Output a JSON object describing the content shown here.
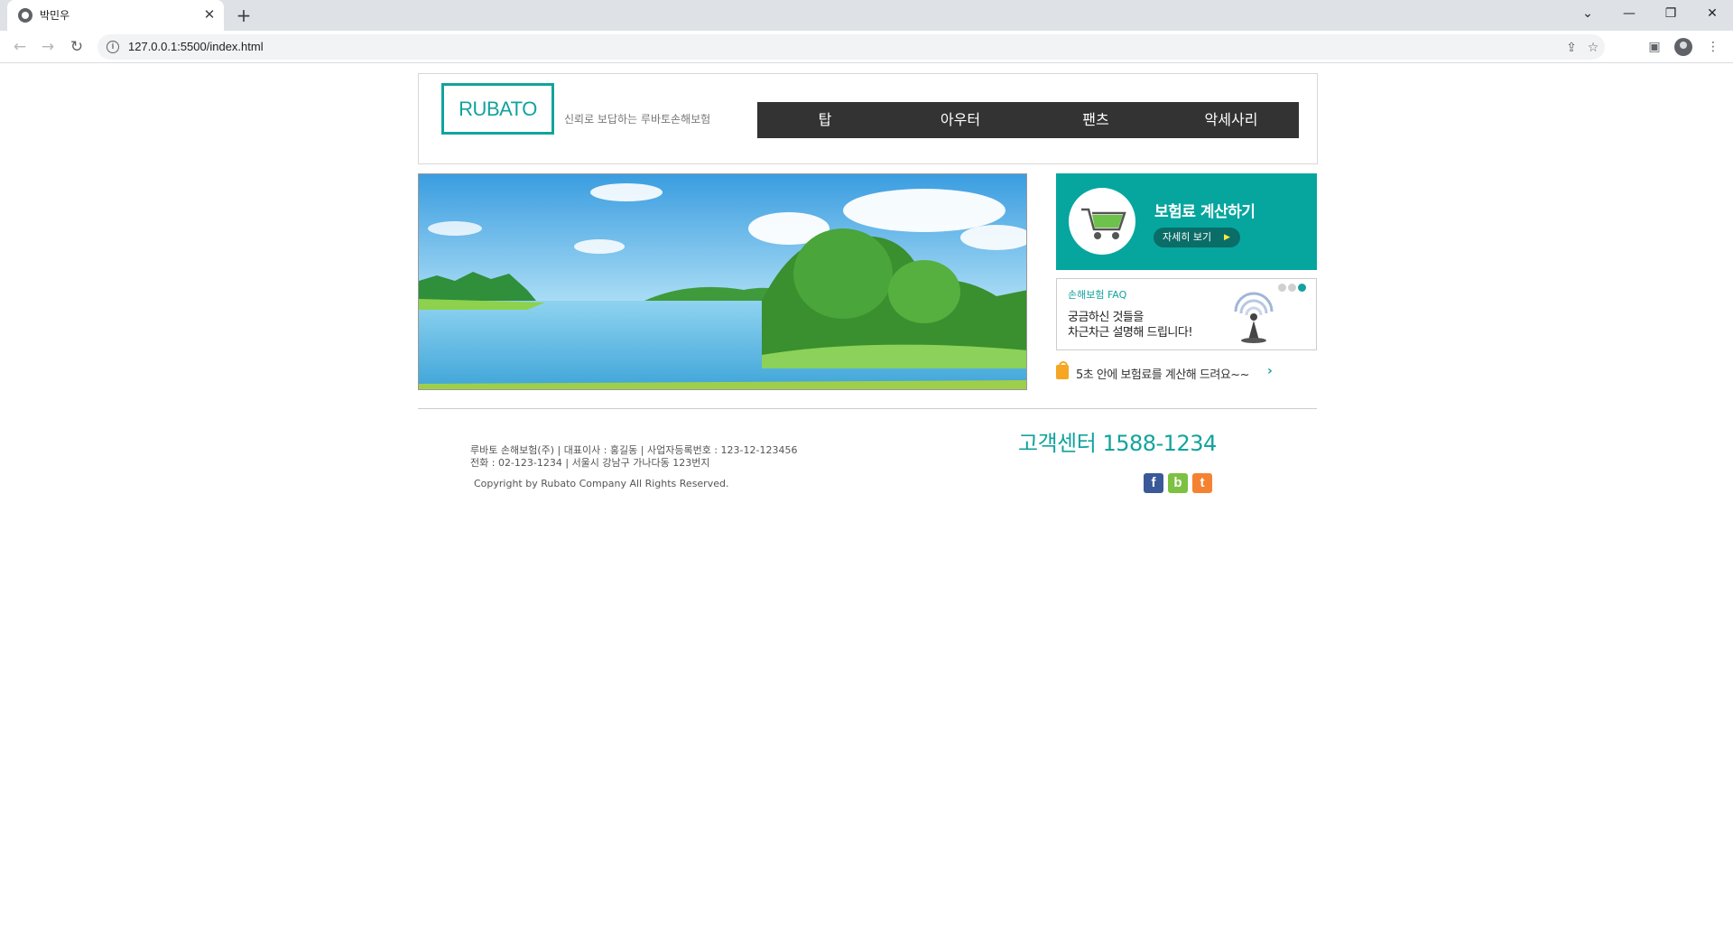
{
  "browser": {
    "tab_title": "박민우",
    "tab_close": "✕",
    "new_tab": "+",
    "url": "127.0.0.1:5500/index.html",
    "window_controls": {
      "list": "⌄",
      "minimize": "—",
      "restore": "❐",
      "close": "✕"
    },
    "nav": {
      "back": "←",
      "forward": "→",
      "reload": "↻"
    }
  },
  "header": {
    "logo": "RUBATO",
    "slogan": "신뢰로 보답하는 루바토손해보험",
    "menu": [
      {
        "label": "탑"
      },
      {
        "label": "아우터"
      },
      {
        "label": "팬츠"
      },
      {
        "label": "악세사리"
      }
    ]
  },
  "side": {
    "calc": {
      "title": "보험료 계산하기",
      "button": "자세히 보기",
      "button_arrow": "▶"
    },
    "faq": {
      "label": "손해보험 FAQ",
      "line1": "궁금하신 것들을",
      "line2": "차근차근 설명해 드립니다!",
      "active_dot": 3
    },
    "promo": {
      "text": "5초 안에 보험료를 계산해 드려요~~",
      "arrow": "›"
    }
  },
  "footer": {
    "info_line1": "루바토 손해보험(주) | 대표이사 : 홍길동 | 사업자등록번호 : 123-12-123456",
    "info_line2": "전화 : 02-123-1234 | 서울시 강남구 가나다동 123번지",
    "copyright": "Copyright by Rubato Company All Rights Reserved.",
    "customer_center": "고객센터 1588-1234",
    "sns": [
      {
        "label": "f",
        "color": "#3b5998"
      },
      {
        "label": "b",
        "color": "#7cc142"
      },
      {
        "label": "t",
        "color": "#f58232"
      }
    ]
  },
  "colors": {
    "accent": "#12a39d",
    "nav_bg": "#333333"
  }
}
